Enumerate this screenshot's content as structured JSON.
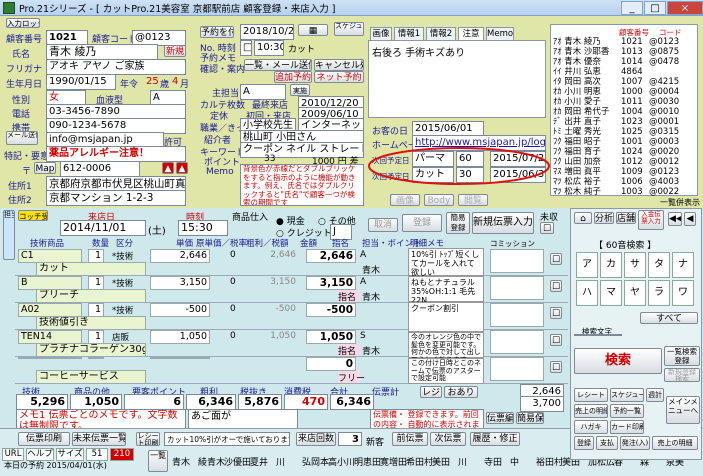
{
  "window": {
    "title": "Pro.21シリーズ - [ カットPro.21美容室  京都駅前店  顧客登録・来店入力 ]",
    "min": "_",
    "max": "□",
    "close": "×"
  },
  "customer": {
    "badge_label": "入力ロック",
    "id_label": "顧客番号",
    "id": "1021",
    "code_label": "顧客コード",
    "code": "@0123",
    "name_label": "氏名",
    "name": "青木 綾乃",
    "new_btn": "新規",
    "furigana_label": "フリガナ",
    "furigana": "アオキ アヤノ ご家族",
    "birth_label": "生年月日",
    "birth": "1990/01/15",
    "age_label": "年令",
    "age": "25",
    "age_unit": "歳",
    "month": "4",
    "month_unit": "月",
    "gender_label": "性別",
    "gender": "女",
    "blood_label": "血液型",
    "blood": "A",
    "tel_label": "電話",
    "tel": "03-3456-7890",
    "mobile_label": "携帯",
    "mobile": "090-1234-5678",
    "mail_btn": "メール送信",
    "mail": "info@msjapan.jp",
    "permit_label": "許可",
    "special_label": "特記・要意",
    "special": "薬品アレルギー注意！",
    "zip_label": "〒",
    "map_btn": "Map",
    "zip": "612-0006",
    "addr_label": "住所1",
    "addr1": "京都府京都市伏見区桃山町真育",
    "addr2_label": "住所2",
    "addr2": "京都マンション 1-2-3"
  },
  "reserve": {
    "btn": "予約を付",
    "date": "2018/10/20",
    "time": "10:30",
    "menu": "カット",
    "no_label": "No. 時刻",
    "no_sub": "予約メモ",
    "calendar": "□",
    "confirm_label": "確認・案内",
    "list_btn": "一覧・メール送信",
    "cancel_btn": "キャンセル処理",
    "add_btn": "追加予約",
    "net_btn": "ネット予約"
  },
  "staff": {
    "main_label": "主担当",
    "main": "A",
    "karte_label": "カルテ枚数",
    "last_label": "最終来店",
    "last": "2010/12/20",
    "regular": "定休",
    "first_label": "初回・来店",
    "first": "2009/06/10",
    "occupation_label": "職業／きっかけ",
    "occupation": "小学校先生",
    "source": "インターネット",
    "intro_label": "紹介者",
    "intro": "桃山町 小田さん",
    "keyword_label": "キーワード",
    "keyword": "クーポン ネイル ストレート",
    "point_label": "ポイント",
    "point": "33",
    "point_yen": "1000 円 差",
    "memo_label": "Memo",
    "memo": "背景色が赤線だとダブルブリッケをすると指示のように機能が動きます。例え、氏名ではダブルクリックすると\"氏名\"で顧客一つが検索の期間です"
  },
  "tabs": [
    "画像",
    "情報1",
    "情報2",
    "注意",
    "Memo"
  ],
  "note": {
    "text": "右後ろ 手術キズあり",
    "visit_label": "お客の日",
    "visit_date": "2015/06/01",
    "url_label": "ホームページ",
    "url": "http://www.msjapan.jp/logoms",
    "next1_label": "次回予定日",
    "next1_menu": "パーマ",
    "next1_days": "60",
    "next1_date": "2015/07/29",
    "next2_label": "次回予定日",
    "next2_menu": "カット",
    "next2_days": "30",
    "next2_date": "2015/06/30",
    "btn_image": "画像",
    "btn_body": "Body",
    "btn_search": "閲覧"
  },
  "customer_list": {
    "header": [
      "顧客番号",
      "コード"
    ],
    "rows": [
      {
        "mark": "ｱｵ",
        "name": "青木 綾乃",
        "num": "1021",
        "code": "@0123"
      },
      {
        "mark": "ｱｵ",
        "name": "青木 沙耶香",
        "num": "1013",
        "code": "@0875"
      },
      {
        "mark": "ｱｵ",
        "name": "青木 優奈",
        "num": "1014",
        "code": "@0478"
      },
      {
        "mark": "ｲｲ",
        "name": "井川 弘恵",
        "num": "4864",
        "code": ""
      },
      {
        "mark": "ｲﾀ",
        "name": "岡田 高次",
        "num": "1007",
        "code": "@4215"
      },
      {
        "mark": "ｵｶ",
        "name": "小川 明恵",
        "num": "1000",
        "code": "@0004"
      },
      {
        "mark": "ｵｶ",
        "name": "小川 愛子",
        "num": "1011",
        "code": "@0030"
      },
      {
        "mark": "ｵｶ",
        "name": "岡田 希代子",
        "num": "1004",
        "code": "@0010"
      },
      {
        "mark": "ﾃﾞ",
        "name": "出井 直子",
        "num": "1023",
        "code": "@0001"
      },
      {
        "mark": "ﾄﾐ",
        "name": "土曜 秀光",
        "num": "1025",
        "code": "@0315"
      },
      {
        "mark": "ﾌｸ",
        "name": "福田 昭子",
        "num": "1001",
        "code": "@0003"
      },
      {
        "mark": "ﾌｸ",
        "name": "福田 育子",
        "num": "1024",
        "code": "@0020"
      },
      {
        "mark": "ﾌｸ",
        "name": "山田 加奈",
        "num": "1012",
        "code": "@0012"
      },
      {
        "mark": "ﾏｽ",
        "name": "増田 眞平",
        "num": "1009",
        "code": "@0123"
      },
      {
        "mark": "ﾏﾂ",
        "name": "松広 裕子",
        "num": "1006",
        "code": "@4003"
      },
      {
        "mark": "ﾏﾂ",
        "name": "松木 純子",
        "num": "1003",
        "code": "@0022"
      }
    ],
    "auto_label": "一覧併表示"
  },
  "visit": {
    "staff_btn": "担当者",
    "copy_btn": "コッチ受け",
    "date_label": "来店日",
    "date": "2014/11/01",
    "dow": "(土)",
    "time_label": "時刻",
    "time": "15:30",
    "goods_label": "商品仕入",
    "cash": "現金",
    "other": "その他",
    "credit": "クレジット",
    "credit_sel": "J",
    "cancel_btn": "取消",
    "register_btn": "登録",
    "quick_btn": "簡易登録",
    "new_btn": "新規伝票入力",
    "unpaid_label": "未収"
  },
  "grid": {
    "headers": [
      "技術商品",
      "数量",
      "区分",
      "単価",
      "原単価／税率",
      "粗利／税額",
      "金額",
      "指名",
      "担当・ボイント",
      "明細メモ"
    ],
    "rows": [
      {
        "code": "C1",
        "name": "カット",
        "qty": "1",
        "kind": "*技術",
        "price": "2,646",
        "rate": "0",
        "gross": "2,646",
        "amount": "2,646",
        "staff_mark": "A",
        "staff": "青木",
        "nom": ""
      },
      {
        "code": "B",
        "name": "ブリーチ",
        "qty": "1",
        "kind": "*技術",
        "price": "3,150",
        "rate": "0",
        "gross": "3,150",
        "amount": "3,150",
        "staff_mark": "A",
        "staff": "青木",
        "nom": "指名"
      },
      {
        "code": "A02",
        "name": "技術値引き",
        "qty": "1",
        "kind": "*技術",
        "price": "-500",
        "rate": "0",
        "gross": "-500",
        "amount": "-500",
        "staff_mark": "",
        "staff": "",
        "nom": ""
      },
      {
        "code": "TEN14",
        "name": "プラチナコラーゲン30g",
        "qty": "1",
        "kind": "店販",
        "price": "1,050",
        "rate": "0",
        "gross": "1,050",
        "amount": "1,050",
        "staff_mark": "S",
        "staff": "青木",
        "nom": "指名"
      },
      {
        "code": "",
        "name": "コーヒーサービス",
        "qty": "",
        "kind": "",
        "price": "",
        "rate": "",
        "gross": "",
        "amount": "0",
        "staff_mark": "",
        "staff": "",
        "nom": "フリー"
      }
    ],
    "memos": [
      "10%引 ﾄｯﾌﾟ短くしてカールを入れて欲しい",
      "ねもとナチュラル35%OH:1:1 毛先22N",
      "クーポン割引",
      "今のオレンジ色の中で髪色を変更可能です。何かの色で対して出してらしく効ります。",
      "この付け日時とこのネームで伝票のアスターで設定可能"
    ]
  },
  "totals": {
    "labels": [
      "技術",
      "商品の他",
      "要客ポイント",
      "粗利",
      "税抜き",
      "消費税",
      "合計",
      "伝票計"
    ],
    "values": [
      "5,296",
      "1,050",
      "6",
      "6,346",
      "5,876",
      "470",
      "6,346",
      ""
    ],
    "pay_label": "レジ",
    "pay": "おあり",
    "change1": "2,646",
    "change2": "3,700"
  },
  "memo_area": {
    "label": "メモ1",
    "text": "メモ1 伝票ごとのメモです。文字数は無制限です。",
    "sub": "あご面が",
    "note2": "伝票備・ 登録できます。前回の内容・ 自動的に表示されます。"
  },
  "bottom_btns": {
    "print": "伝票印刷",
    "unfinished": "未来伝票一覧",
    "receipt": "レシート印刷",
    "cut_note": "カット10%引がオーで施いております。",
    "count_label": "来店回数",
    "count": "3",
    "new_label": "新客",
    "prev": "前伝票",
    "next": "次伝票",
    "history": "履歴・修正",
    "edit": "伝票編集",
    "quick_save": "簡易保存"
  },
  "status": {
    "url": "URL",
    "help": "ヘルプ",
    "size": "サイズ",
    "num1": "51",
    "num2": "210",
    "today": "本日の予約 2015/04/01(水)",
    "today_btn": "一覧"
  },
  "name_chips": [
    "青木",
    "綾青木",
    "沙優田",
    "夏井",
    "川",
    "弘岡本",
    "高小川",
    "明恵田",
    "寛増田",
    "希田村",
    "美田",
    "川",
    "寺田",
    "中",
    "裕田村",
    "美田",
    "加松広",
    "春",
    "森",
    "泉美"
  ],
  "search_panel": {
    "title": "【 60音検索 】",
    "kana": [
      [
        "ア",
        "カ",
        "サ",
        "タ",
        "ナ"
      ],
      [
        "ハ",
        "マ",
        "ヤ",
        "ラ",
        "ワ"
      ]
    ],
    "all_btn": "すべて",
    "search_label": "検索文字",
    "search_btn": "検索",
    "kinds_btn": "一覧検索登録",
    "new_btn": "新規登録検索",
    "side_btns": [
      "レシート",
      "スケジュール",
      "週計",
      "売上の明細",
      "予約一覧",
      "ハガキ",
      "カード印刷",
      "登録",
      "支払",
      "発注(入)",
      "売上の明細"
    ],
    "main_menu": "メインメニューへ",
    "nav": [
      "◀◀",
      "◀",
      "▶",
      "▶▶"
    ]
  }
}
